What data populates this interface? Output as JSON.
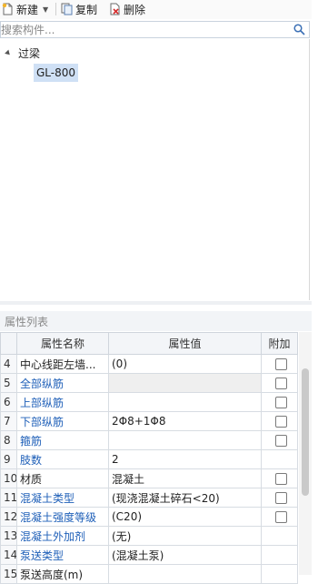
{
  "toolbar": {
    "new_label": "新建",
    "copy_label": "复制",
    "delete_label": "删除"
  },
  "search": {
    "placeholder": "搜索构件..."
  },
  "tree": {
    "root_label": "过梁",
    "child_label": "GL-800"
  },
  "properties": {
    "header": "属性列表",
    "columns": [
      "属性名称",
      "属性值",
      "附加"
    ],
    "rows": [
      {
        "num": "4",
        "name": "中心线距左墙...",
        "value": "(0)",
        "blue": false,
        "checkbox": true
      },
      {
        "num": "5",
        "name": "全部纵筋",
        "value": "",
        "blue": true,
        "checkbox": true
      },
      {
        "num": "6",
        "name": "上部纵筋",
        "value": "",
        "blue": true,
        "checkbox": true
      },
      {
        "num": "7",
        "name": "下部纵筋",
        "value": "2Φ8+1Φ8",
        "blue": true,
        "checkbox": true
      },
      {
        "num": "8",
        "name": "箍筋",
        "value": "",
        "blue": true,
        "checkbox": true
      },
      {
        "num": "9",
        "name": "肢数",
        "value": "2",
        "blue": true,
        "checkbox": false
      },
      {
        "num": "10",
        "name": "材质",
        "value": "混凝土",
        "blue": false,
        "checkbox": true
      },
      {
        "num": "11",
        "name": "混凝土类型",
        "value": "(现浇混凝土碎石<20)",
        "blue": true,
        "checkbox": true
      },
      {
        "num": "12",
        "name": "混凝土强度等级",
        "value": "(C20)",
        "blue": true,
        "checkbox": true
      },
      {
        "num": "13",
        "name": "混凝土外加剂",
        "value": "(无)",
        "blue": true,
        "checkbox": false
      },
      {
        "num": "14",
        "name": "泵送类型",
        "value": "(混凝土泵)",
        "blue": true,
        "checkbox": false
      },
      {
        "num": "15",
        "name": "泵送高度(m)",
        "value": "",
        "blue": false,
        "checkbox": false
      }
    ]
  }
}
